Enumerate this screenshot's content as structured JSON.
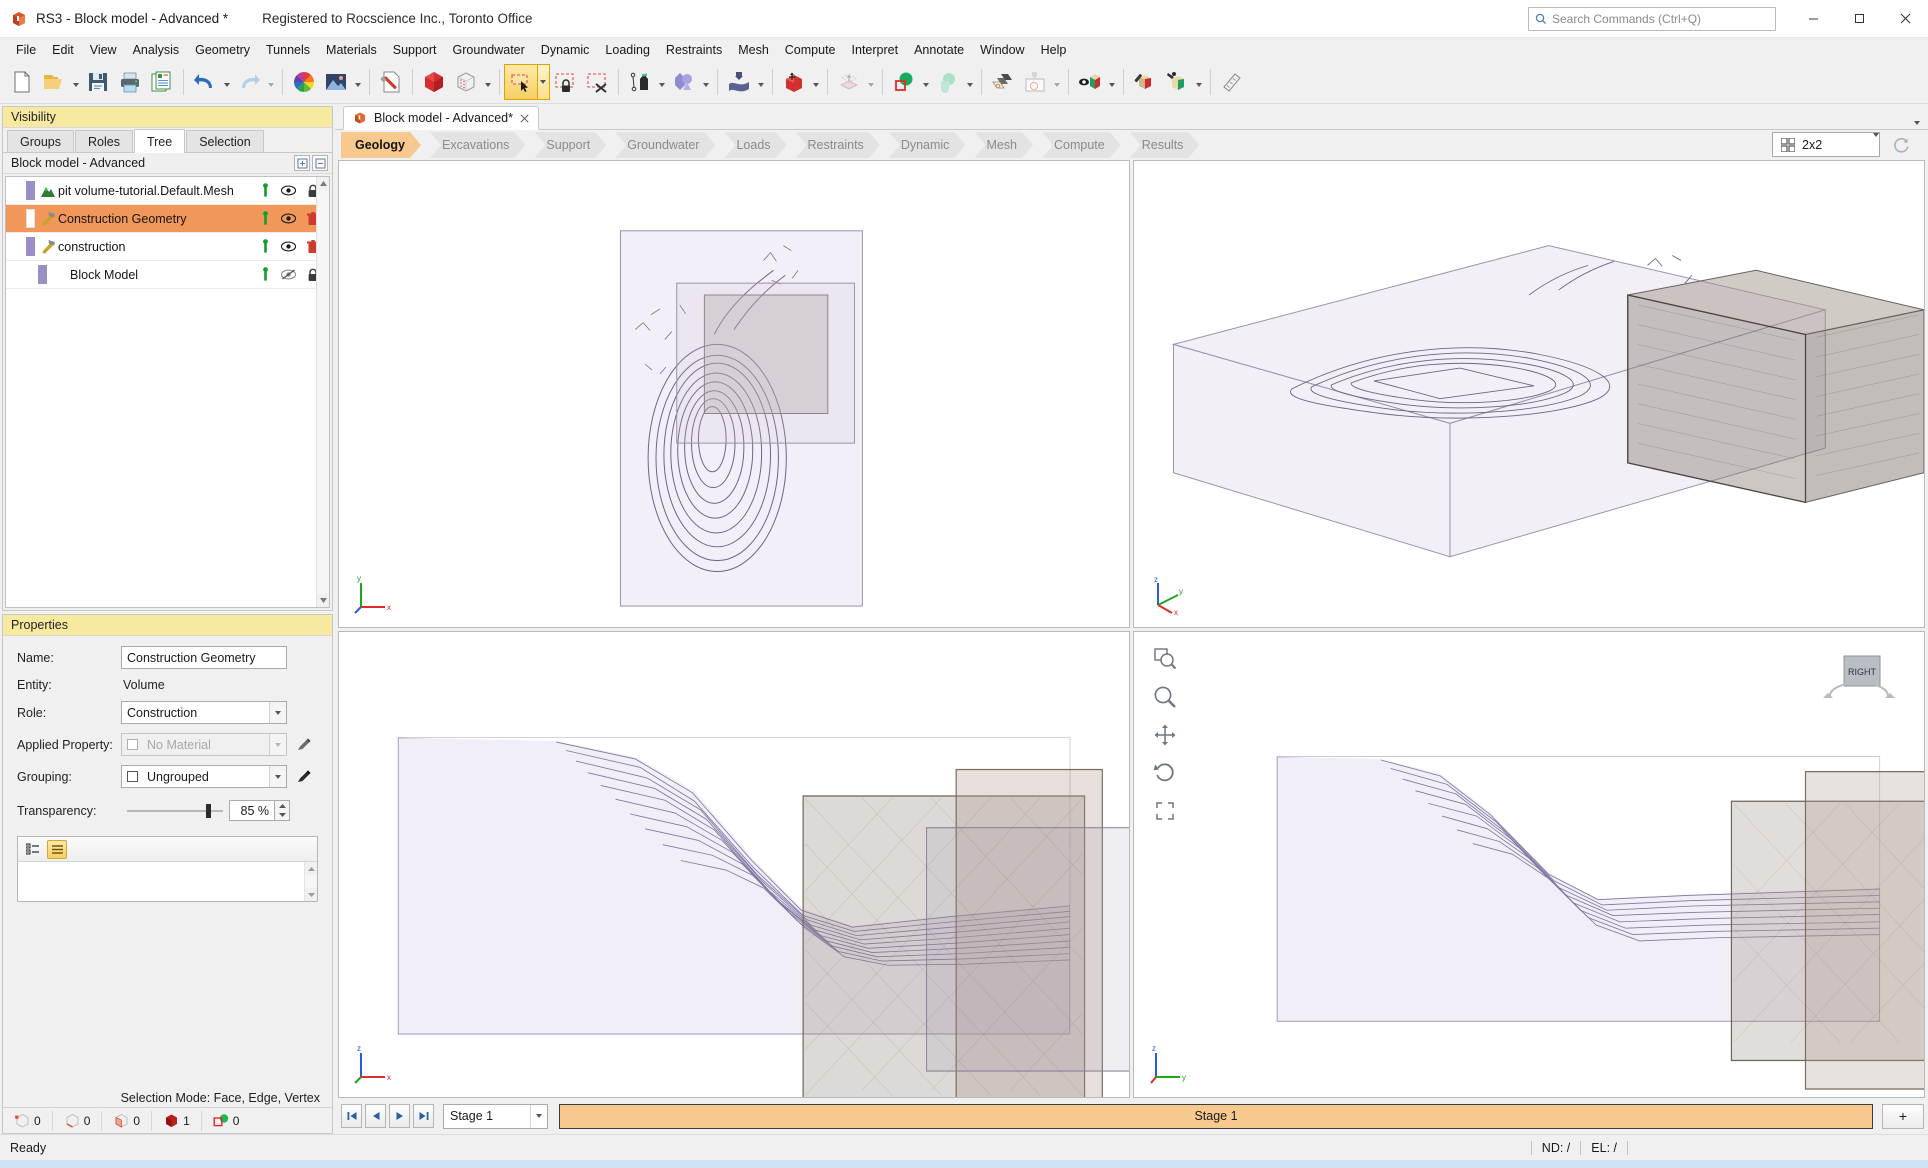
{
  "titlebar": {
    "app_icon": "rs3-logo-icon",
    "title": "RS3 - Block model - Advanced *",
    "registration": "Registered to Rocscience Inc., Toronto Office",
    "search_placeholder": "Search Commands (Ctrl+Q)",
    "minimize": "minimize-button",
    "maximize": "maximize-button",
    "close": "close-button"
  },
  "menubar": {
    "items": [
      {
        "label": "File"
      },
      {
        "label": "Edit"
      },
      {
        "label": "View"
      },
      {
        "label": "Analysis"
      },
      {
        "label": "Geometry"
      },
      {
        "label": "Tunnels"
      },
      {
        "label": "Materials"
      },
      {
        "label": "Support"
      },
      {
        "label": "Groundwater"
      },
      {
        "label": "Dynamic"
      },
      {
        "label": "Loading"
      },
      {
        "label": "Restraints"
      },
      {
        "label": "Mesh"
      },
      {
        "label": "Compute"
      },
      {
        "label": "Interpret"
      },
      {
        "label": "Annotate"
      },
      {
        "label": "Window"
      },
      {
        "label": "Help"
      }
    ]
  },
  "toolbar": {
    "groups": [
      {
        "tools": [
          {
            "name": "new-file-icon",
            "caret": false
          },
          {
            "name": "open-file-icon",
            "caret": true
          },
          {
            "name": "save-icon",
            "caret": false
          },
          {
            "name": "print-icon",
            "caret": false
          },
          {
            "name": "report-generator-icon",
            "caret": false
          }
        ]
      },
      {
        "tools": [
          {
            "name": "undo-icon",
            "caret": true
          },
          {
            "name": "redo-icon",
            "caret": true
          }
        ]
      },
      {
        "tools": [
          {
            "name": "color-wheel-icon",
            "caret": false
          },
          {
            "name": "image-background-icon",
            "caret": true
          }
        ]
      },
      {
        "tools": [
          {
            "name": "design-tool-icon",
            "caret": false
          }
        ]
      },
      {
        "tools": [
          {
            "name": "solid-volume-icon",
            "caret": false
          },
          {
            "name": "mesh-box-icon",
            "caret": true
          }
        ]
      },
      {
        "tools": [
          {
            "name": "select-box-tool-icon",
            "caret": true,
            "active": true
          },
          {
            "name": "lock-selection-icon",
            "caret": false
          },
          {
            "name": "clear-selection-icon",
            "caret": false
          }
        ]
      },
      {
        "tools": [
          {
            "name": "pen-polyline-icon",
            "caret": true
          },
          {
            "name": "boolean-shapes-icon",
            "caret": true
          }
        ]
      },
      {
        "tools": [
          {
            "name": "import-surface-icon",
            "caret": true
          }
        ]
      },
      {
        "tools": [
          {
            "name": "move-volume-icon",
            "caret": true
          }
        ]
      },
      {
        "tools": [
          {
            "name": "extrude-icon",
            "caret": true
          }
        ]
      },
      {
        "tools": [
          {
            "name": "material-sphere-icon",
            "caret": true
          },
          {
            "name": "overlap-shapes-icon",
            "caret": true
          }
        ]
      },
      {
        "tools": [
          {
            "name": "layers-icon",
            "caret": false
          },
          {
            "name": "image-import-icon",
            "caret": true
          }
        ]
      },
      {
        "tools": [
          {
            "name": "visibility-block-icon",
            "caret": true
          }
        ]
      },
      {
        "tools": [
          {
            "name": "edit-block-icon",
            "caret": false
          },
          {
            "name": "block-tools-icon",
            "caret": true
          }
        ]
      },
      {
        "tools": [
          {
            "name": "measure-icon",
            "caret": false
          }
        ]
      }
    ]
  },
  "visibility_panel": {
    "header": "Visibility",
    "tabs": [
      {
        "label": "Groups",
        "active": false
      },
      {
        "label": "Roles",
        "active": false
      },
      {
        "label": "Tree",
        "active": true
      },
      {
        "label": "Selection",
        "active": false
      }
    ],
    "tree_title": "Block model - Advanced",
    "tree_title_buttons": [
      "expand-all-button",
      "collapse-all-button"
    ],
    "tree_rows": [
      {
        "label": "pit volume-tutorial.Default.Mesh",
        "icon": "terrain-mesh-icon",
        "swatch": "#9b8ec4",
        "selected": false,
        "actions": [
          "pin-icon",
          "eye-visible-icon",
          "lock-icon"
        ]
      },
      {
        "label": "Construction Geometry",
        "icon": "construction-hammer-icon",
        "swatch": "#ffffff",
        "selected": true,
        "actions": [
          "pin-icon",
          "eye-visible-icon",
          "delete-icon"
        ]
      },
      {
        "label": "construction",
        "icon": "construction-hammer-icon",
        "swatch": "#9b8ec4",
        "selected": false,
        "actions": [
          "pin-icon",
          "eye-visible-icon",
          "delete-icon"
        ]
      },
      {
        "label": "Block Model",
        "icon": "",
        "swatch": "#9b8ec4",
        "selected": false,
        "actions": [
          "pin-icon",
          "eye-hidden-icon",
          "lock-icon"
        ]
      }
    ]
  },
  "properties_panel": {
    "header": "Properties",
    "fields": {
      "name_label": "Name:",
      "name_value": "Construction Geometry",
      "entity_label": "Entity:",
      "entity_value": "Volume",
      "role_label": "Role:",
      "role_value": "Construction",
      "applied_property_label": "Applied Property:",
      "applied_property_value": "No Material",
      "grouping_label": "Grouping:",
      "grouping_value": "Ungrouped",
      "transparency_label": "Transparency:",
      "transparency_value": "85 %",
      "transparency_percent": 85
    },
    "list_toolbar": [
      {
        "name": "list-detail-view-button",
        "selected": false
      },
      {
        "name": "list-compact-view-button",
        "selected": true
      }
    ]
  },
  "selection_status": {
    "mode_text": "Selection Mode: Face, Edge, Vertex",
    "counts": [
      {
        "icon": "vertex-count-icon",
        "value": "0"
      },
      {
        "icon": "edge-count-icon",
        "value": "0"
      },
      {
        "icon": "face-count-icon",
        "value": "0"
      },
      {
        "icon": "volume-count-icon",
        "value": "1"
      },
      {
        "icon": "group-count-icon",
        "value": "0"
      }
    ]
  },
  "document": {
    "tab_label": "Block model - Advanced*",
    "tab_icon": "rs3-doc-icon",
    "tab_close": "close-tab-icon",
    "overflow": "tab-overflow-caret"
  },
  "workflow_tabs": [
    {
      "label": "Geology",
      "active": true
    },
    {
      "label": "Excavations",
      "active": false
    },
    {
      "label": "Support",
      "active": false
    },
    {
      "label": "Groundwater",
      "active": false
    },
    {
      "label": "Loads",
      "active": false
    },
    {
      "label": "Restraints",
      "active": false
    },
    {
      "label": "Dynamic",
      "active": false
    },
    {
      "label": "Mesh",
      "active": false
    },
    {
      "label": "Compute",
      "active": false
    },
    {
      "label": "Results",
      "active": false
    }
  ],
  "view_layout": {
    "icon": "grid-2x2-icon",
    "value": "2x2",
    "refresh_icon": "refresh-views-icon"
  },
  "viewports": [
    {
      "name": "viewport-top-left",
      "axes": "axis-triad-yx",
      "orientation": "top-plan"
    },
    {
      "name": "viewport-top-right",
      "axes": "axis-triad-zyx",
      "orientation": "isometric-3d"
    },
    {
      "name": "viewport-bottom-left",
      "axes": "axis-triad-zx",
      "orientation": "front-section"
    },
    {
      "name": "viewport-bottom-right",
      "axes": "axis-triad-zx",
      "orientation": "right-section",
      "nav_tools": [
        "zoom-window-icon",
        "zoom-icon",
        "pan-icon",
        "rotate-icon",
        "zoom-extents-icon"
      ],
      "view_cube_label": "RIGHT"
    }
  ],
  "stage_bar": {
    "first_button": "first-stage-button",
    "prev_button": "previous-stage-button",
    "next_button": "next-stage-button",
    "last_button": "last-stage-button",
    "stage_value": "Stage 1",
    "timeline_label": "Stage 1",
    "add_button": "+"
  },
  "statusbar": {
    "message": "Ready",
    "node_label": "ND: /",
    "element_label": "EL: /"
  }
}
